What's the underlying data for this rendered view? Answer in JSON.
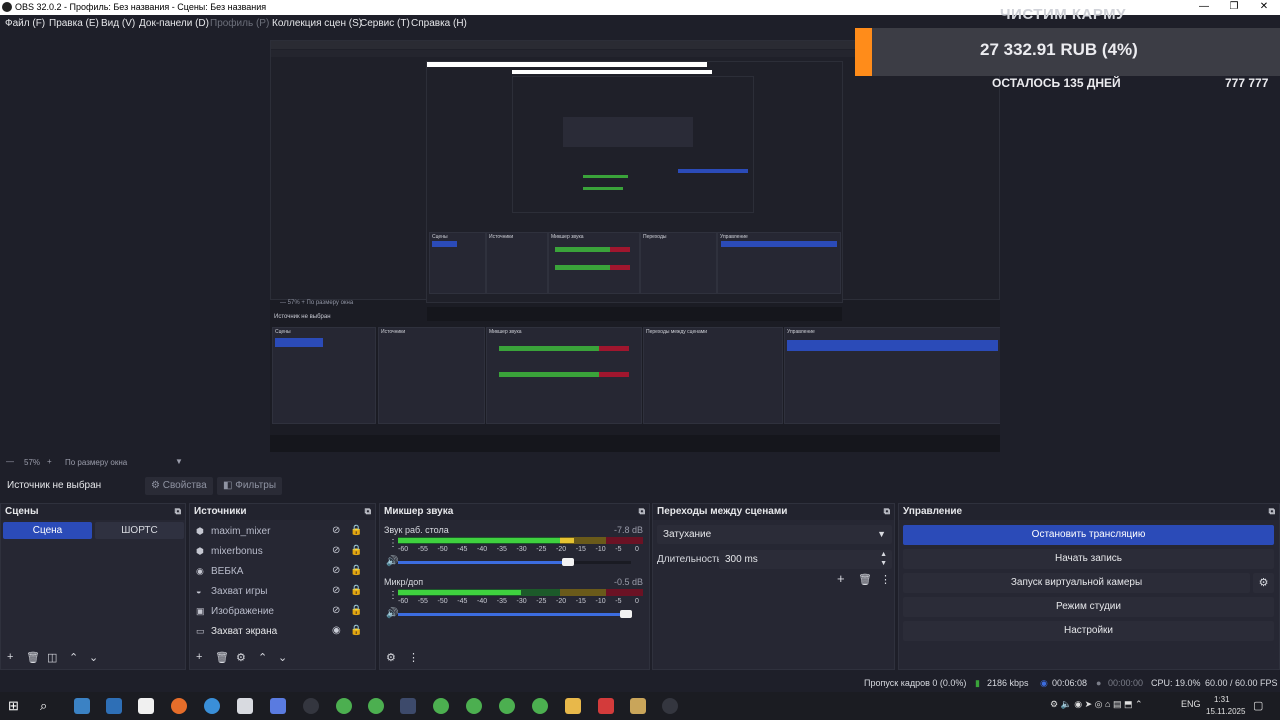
{
  "window": {
    "title": "OBS 32.0.2 - Профиль: Без названия - Сцены: Без названия"
  },
  "menu": [
    "Файл (F)",
    "Правка (E)",
    "Вид (V)",
    "Док-панели (D)",
    "Профиль (P)",
    "Коллекция сцен (S)",
    "Сервис (T)",
    "Справка (H)"
  ],
  "overlay": {
    "header": "ЧИСТИМ КАРМУ",
    "amount": "27 332.91 RUB (4%)",
    "progress_fraction": 0.04,
    "days_left": "ОСТАЛОСЬ 135 ДНЕЙ",
    "goal": "777 777"
  },
  "zoom": {
    "percent": "57%",
    "mode": "По размеру окна"
  },
  "source_bar": {
    "status": "Источник не выбран",
    "properties": "Свойства",
    "filters": "Фильтры"
  },
  "scenes": {
    "title": "Сцены",
    "items": [
      "Сцена",
      "ШОРТС"
    ]
  },
  "sources": {
    "title": "Источники",
    "items": [
      {
        "name": "maxim_mixer",
        "icon": "browser-icon"
      },
      {
        "name": "mixerbonus",
        "icon": "browser-icon"
      },
      {
        "name": "ВЕБКА",
        "icon": "camera-icon"
      },
      {
        "name": "Захват игры",
        "icon": "gamepad-icon"
      },
      {
        "name": "Изображение",
        "icon": "image-icon"
      },
      {
        "name": "Захват экрана",
        "icon": "monitor-icon"
      }
    ]
  },
  "mixer": {
    "title": "Микшер звука",
    "scale": [
      "-60",
      "-55",
      "-50",
      "-45",
      "-40",
      "-35",
      "-30",
      "-25",
      "-20",
      "-15",
      "-10",
      "-5",
      "0"
    ],
    "channels": [
      {
        "name": "Звук раб. стола",
        "db": "-7.8 dB",
        "level": 0.72,
        "volume": 0.73
      },
      {
        "name": "Микр/доп",
        "db": "-0.5 dB",
        "level": 0.5,
        "volume": 0.98
      }
    ]
  },
  "transitions": {
    "title": "Переходы между сценами",
    "selected": "Затухание",
    "duration_label": "Длительность",
    "duration": "300 ms"
  },
  "controls": {
    "title": "Управление",
    "buttons": [
      "Остановить трансляцию",
      "Начать запись",
      "Запуск виртуальной камеры",
      "Режим студии",
      "Настройки"
    ]
  },
  "status": {
    "dropped": "Пропуск кадров 0 (0.0%)",
    "bitrate": "2186 kbps",
    "stream_time": "00:06:08",
    "rec_time": "00:00:00",
    "cpu": "CPU: 19.0%",
    "fps": "60.00 / 60.00 FPS"
  },
  "taskbar": {
    "lang": "ENG",
    "time": "1:31",
    "date": "15.11.2025"
  },
  "colors": {
    "accent": "#2b4bb8",
    "orange": "#ff8c1a",
    "green": "#3aa33a",
    "red": "#a0162e"
  }
}
